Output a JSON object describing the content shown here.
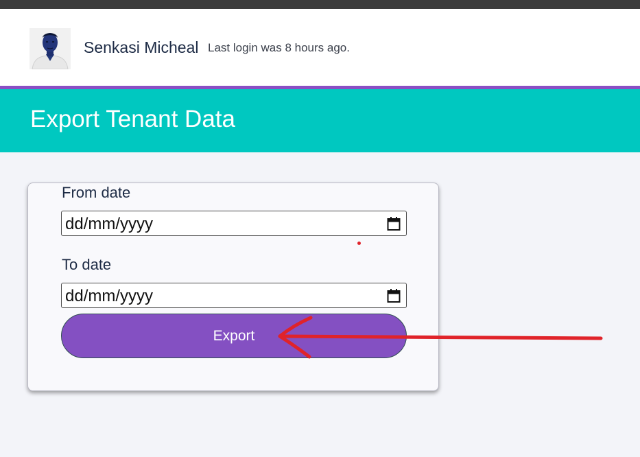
{
  "header": {
    "user_name": "Senkasi Micheal",
    "last_login": "Last login was 8 hours ago."
  },
  "page": {
    "title": "Export Tenant Data"
  },
  "form": {
    "from_label": "From date",
    "from_value": "dd/mm/yyyy",
    "to_label": "To date",
    "to_value": "dd/mm/yyyy",
    "export_label": "Export"
  },
  "icons": {
    "from_picker": "calendar-icon",
    "to_picker": "calendar-icon"
  },
  "colors": {
    "top_bar": "#3b3b3b",
    "accent_strip": "#8a4fc4",
    "title_band": "#00c8c0",
    "button": "#8450c2",
    "annotation": "#e0232a"
  }
}
